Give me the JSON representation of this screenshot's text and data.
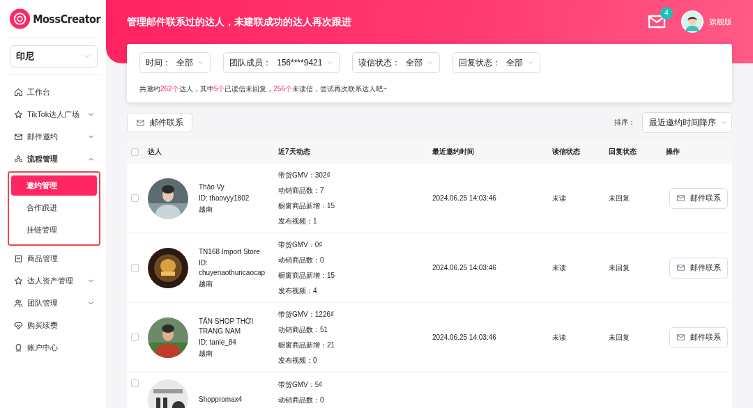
{
  "brand": {
    "name": "MossCreator"
  },
  "region_select": {
    "value": "印尼"
  },
  "nav": [
    {
      "label": "工作台",
      "kind": "link",
      "selected": false
    },
    {
      "label": "TikTok达人广场",
      "kind": "group",
      "selected": false,
      "expanded": false
    },
    {
      "label": "邮件邀约",
      "kind": "group",
      "selected": false,
      "expanded": false
    },
    {
      "label": "流程管理",
      "kind": "group",
      "selected": false,
      "expanded": true,
      "children": [
        {
          "label": "邀约管理",
          "selected": true
        },
        {
          "label": "合作跟进",
          "selected": false
        },
        {
          "label": "挂链管理",
          "selected": false
        }
      ]
    },
    {
      "label": "商品管理",
      "kind": "link",
      "selected": false
    },
    {
      "label": "达人资产管理",
      "kind": "group",
      "selected": false,
      "expanded": false
    },
    {
      "label": "团队管理",
      "kind": "group",
      "selected": false,
      "expanded": false
    },
    {
      "label": "购买续费",
      "kind": "link",
      "selected": false
    },
    {
      "label": "账户中心",
      "kind": "link",
      "selected": false
    }
  ],
  "header": {
    "title": "管理邮件联系过的达人，未建联成功的达人再次跟进",
    "mail_badge": "4",
    "plan": "旗舰版"
  },
  "filters": [
    {
      "label": "时间：",
      "value": "全部"
    },
    {
      "label": "团队成员：",
      "value": "156****9421"
    },
    {
      "label": "读信状态：",
      "value": "全部"
    },
    {
      "label": "回复状态：",
      "value": "全部"
    }
  ],
  "summary": [
    {
      "text": "共邀约",
      "highlight": false
    },
    {
      "text": "262个",
      "highlight": true
    },
    {
      "text": "达人，其中",
      "highlight": false
    },
    {
      "text": "5个",
      "highlight": true
    },
    {
      "text": "已读信未回复，",
      "highlight": false
    },
    {
      "text": "256个",
      "highlight": true
    },
    {
      "text": "未读信，尝试再次联系达人吧~",
      "highlight": false
    }
  ],
  "toolbar": {
    "button": "邮件联系",
    "sort_label": "排序：",
    "sort_value": "最近邀约时间降序"
  },
  "table": {
    "header_checked": false,
    "columns": [
      "达人",
      "近7天动态",
      "最近邀约时间",
      "读信状态",
      "回复状态",
      "操作"
    ],
    "rows": [
      {
        "checked": false,
        "name": "Thảo Vy",
        "id": "ID: thaovyy1802",
        "region": "越南",
        "stats": [
          "带货GMV：302₫",
          "动销商品数：7",
          "橱窗商品新增：15",
          "发布视频：1"
        ],
        "time": "2024.06.25 14:03:46",
        "read": "未读",
        "reply": "未回复",
        "action": "邮件联系"
      },
      {
        "checked": false,
        "name": "TN168 Import Store",
        "id": "ID: chuyenaothuncaocap",
        "region": "越南",
        "stats": [
          "带货GMV：0₫",
          "动销商品数：0",
          "橱窗商品新增：15",
          "发布视频：4"
        ],
        "time": "2024.06.25 14:03:46",
        "read": "未读",
        "reply": "未回复",
        "action": "邮件联系"
      },
      {
        "checked": false,
        "name": "TẤN SHOP THỜI TRANG NAM",
        "id": "ID: tanle_84",
        "region": "越南",
        "stats": [
          "带货GMV：1226₫",
          "动销商品数：51",
          "橱窗商品新增：21",
          "发布视频：0"
        ],
        "time": "2024.06.25 14:03:46",
        "read": "未读",
        "reply": "未回复",
        "action": "邮件联系"
      },
      {
        "checked": false,
        "name": "Shoppromax4",
        "stats": [
          "带货GMV：5₫",
          "动销商品数：0"
        ]
      }
    ]
  }
}
